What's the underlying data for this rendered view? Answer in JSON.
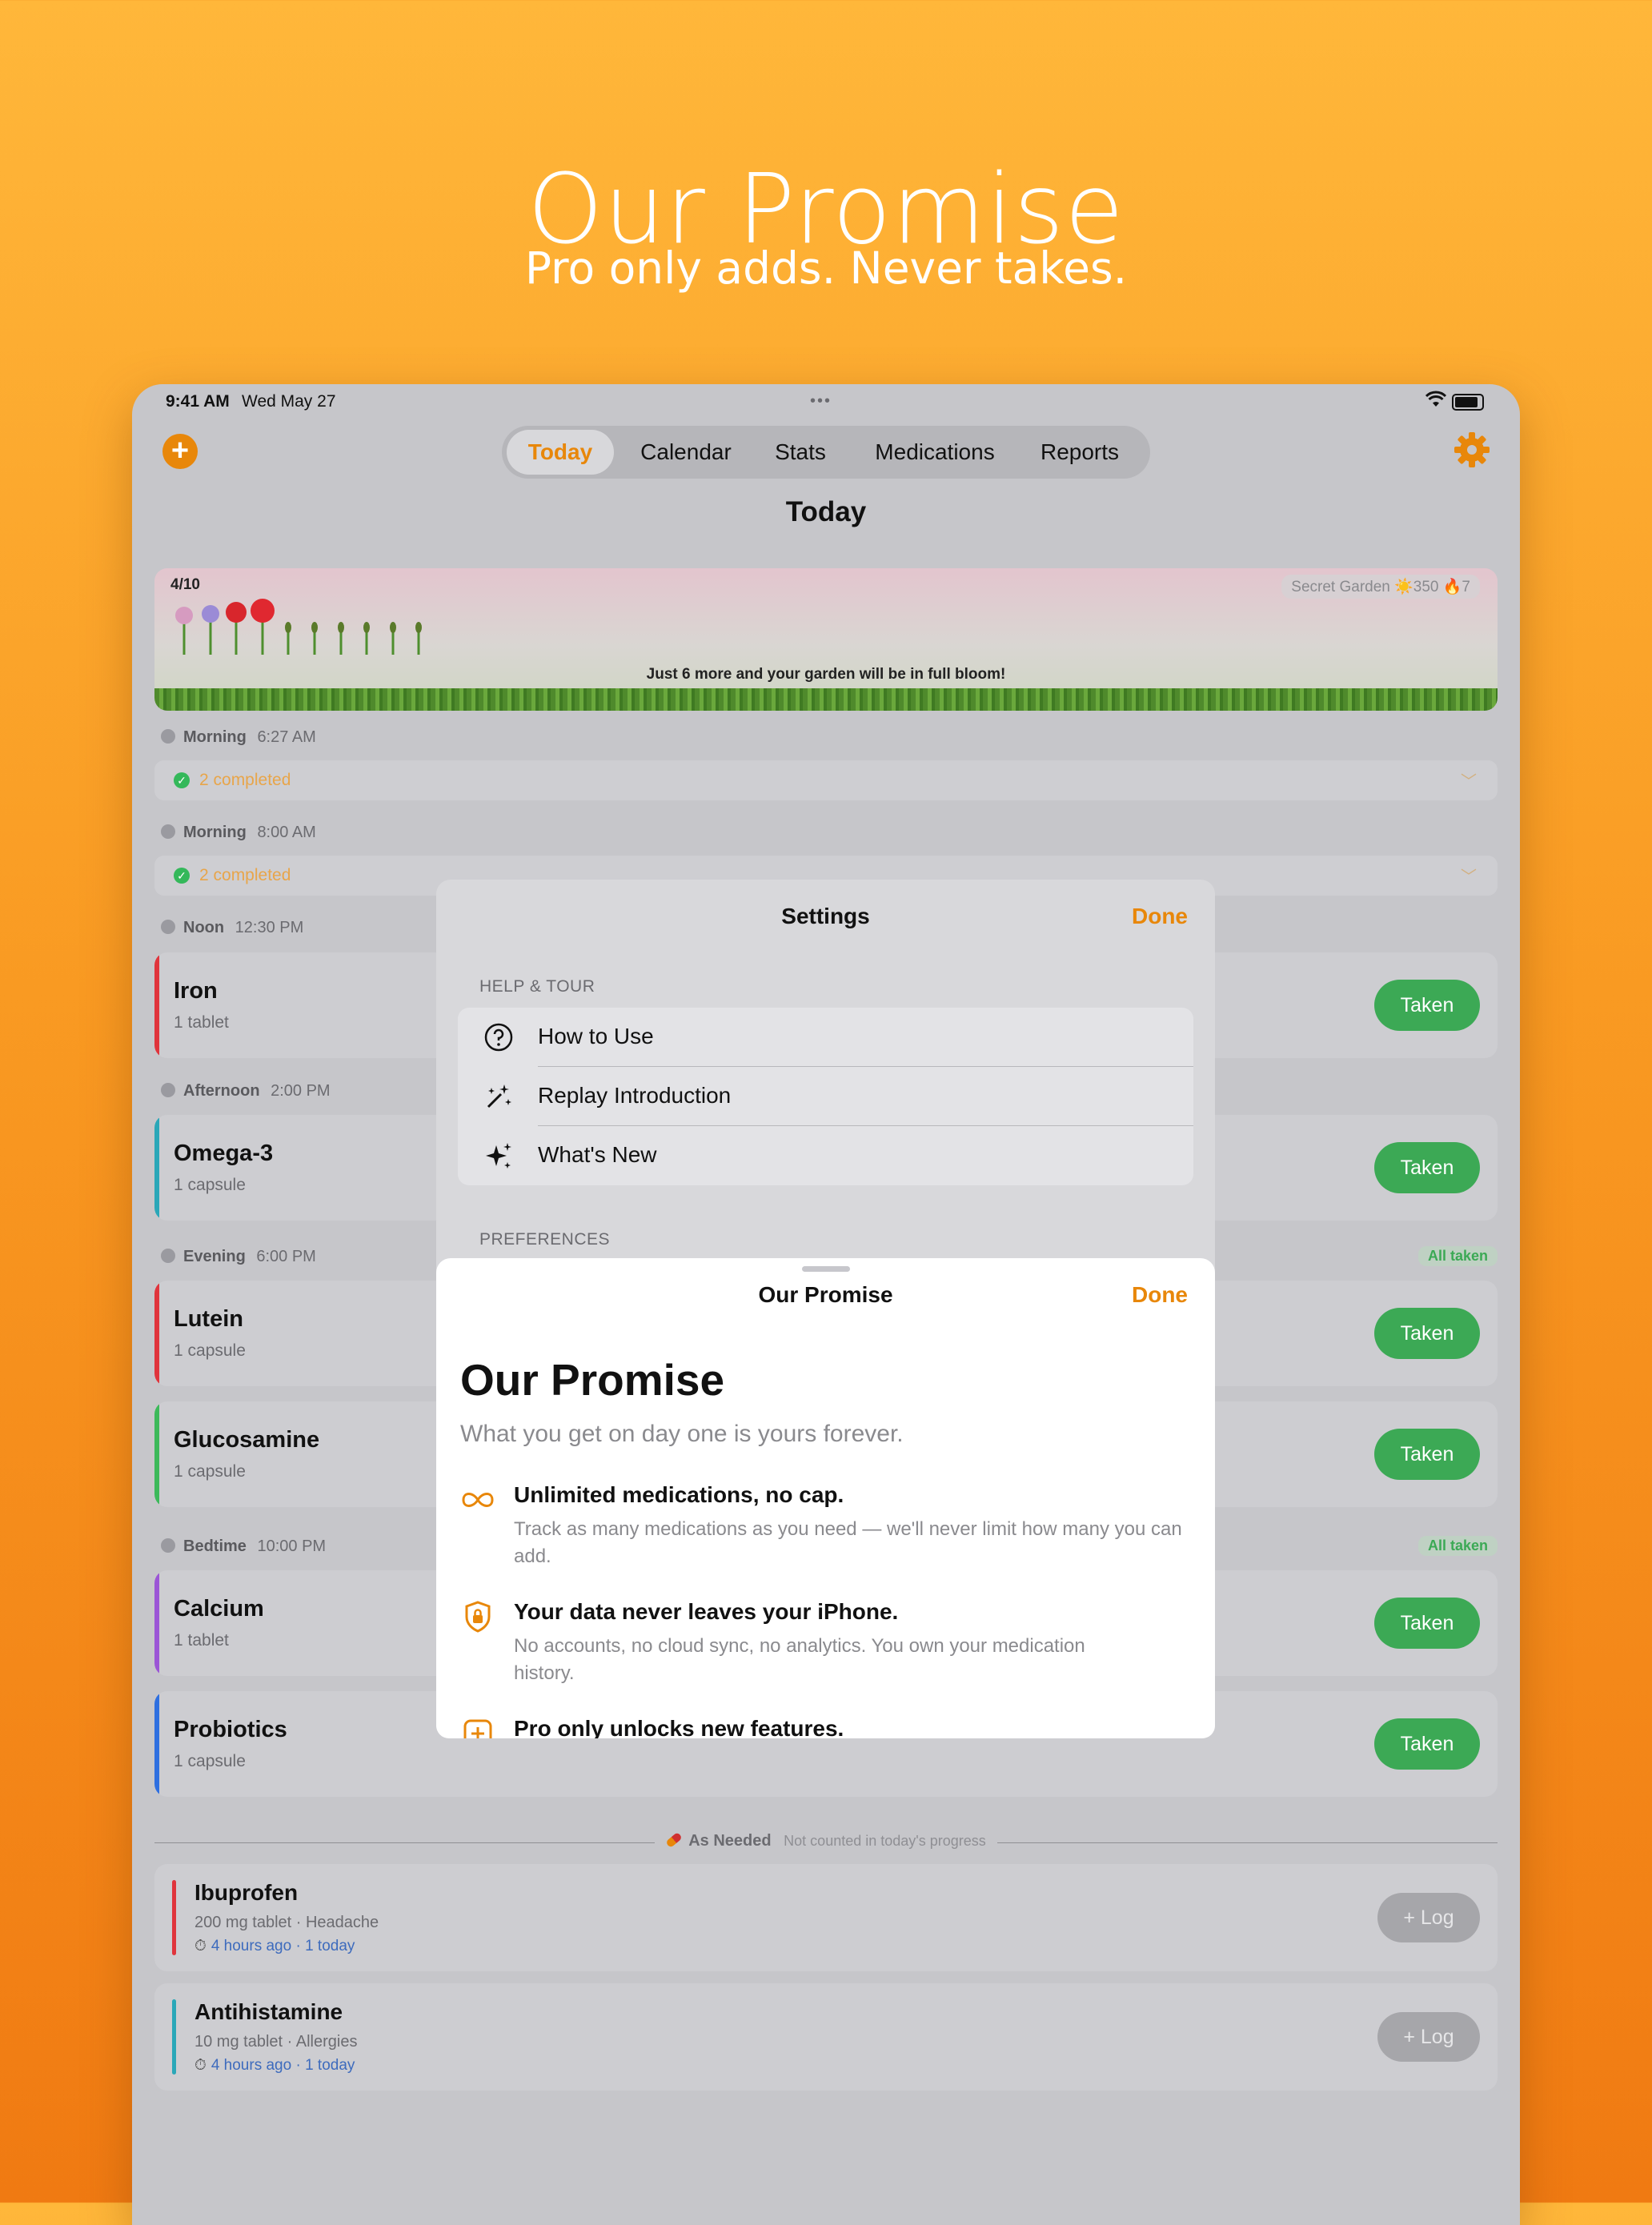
{
  "hero": {
    "title": "Our Promise",
    "subtitle": "Pro only adds. Never takes."
  },
  "statusbar": {
    "time": "9:41 AM",
    "date": "Wed May 27",
    "dots": "•••"
  },
  "toolbar": {
    "add_icon": "+"
  },
  "tabs": [
    {
      "label": "Today",
      "active": true
    },
    {
      "label": "Calendar"
    },
    {
      "label": "Stats"
    },
    {
      "label": "Medications"
    },
    {
      "label": "Reports"
    }
  ],
  "page": {
    "title": "Today"
  },
  "garden": {
    "count": "4/10",
    "badge": "Secret Garden ☀️350 🔥7",
    "message": "Just 6 more and your garden will be in full bloom!"
  },
  "schedule": {
    "morning1": {
      "label": "Morning",
      "time": "6:27 AM",
      "completed": "2 completed"
    },
    "morning2": {
      "label": "Morning",
      "time": "8:00 AM",
      "completed": "2 completed"
    },
    "noon": {
      "label": "Noon",
      "time": "12:30 PM"
    },
    "afternoon": {
      "label": "Afternoon",
      "time": "2:00 PM"
    },
    "evening": {
      "label": "Evening",
      "time": "6:00 PM",
      "badge": "All taken"
    },
    "bedtime": {
      "label": "Bedtime",
      "time": "10:00 PM",
      "badge": "All taken"
    }
  },
  "medications": [
    {
      "name": "Iron",
      "dose": "1 tablet",
      "button": "Taken",
      "color": "#E0343C"
    },
    {
      "name": "Omega-3",
      "dose": "1 capsule",
      "button": "Taken",
      "color": "#2AA7B8"
    },
    {
      "name": "Lutein",
      "dose": "1 capsule",
      "button": "Taken",
      "color": "#E0343C"
    },
    {
      "name": "Glucosamine",
      "dose": "1 capsule",
      "button": "Taken",
      "color": "#3CB95A"
    },
    {
      "name": "Calcium",
      "dose": "1 tablet",
      "button": "Taken",
      "color": "#9B55D6"
    },
    {
      "name": "Probiotics",
      "dose": "1 capsule",
      "button": "Taken",
      "color": "#2E6FE0"
    }
  ],
  "as_needed": {
    "label": "As Needed",
    "note": "Not counted in today's progress",
    "items": [
      {
        "name": "Ibuprofen",
        "dose": "200 mg tablet · Headache",
        "last": "4 hours ago · 1 today",
        "button": "+ Log",
        "color": "#E0343C"
      },
      {
        "name": "Antihistamine",
        "dose": "10 mg tablet · Allergies",
        "last": "4 hours ago · 1 today",
        "button": "+ Log",
        "color": "#2AA7B8"
      }
    ]
  },
  "settings": {
    "title": "Settings",
    "done": "Done",
    "section_help": "HELP & TOUR",
    "rows": [
      {
        "label": "How to Use",
        "icon": "question-circle-icon"
      },
      {
        "label": "Replay Introduction",
        "icon": "magic-wand-icon"
      },
      {
        "label": "What's New",
        "icon": "sparkles-icon"
      }
    ],
    "section_prefs": "PREFERENCES"
  },
  "promise": {
    "nav_title": "Our Promise",
    "done": "Done",
    "heading": "Our Promise",
    "subheading": "What you get on day one is yours forever.",
    "items": [
      {
        "icon": "infinity-icon",
        "title": "Unlimited medications, no cap.",
        "desc": "Track as many medications as you need — we'll never limit how many you can add."
      },
      {
        "icon": "lock-shield-icon",
        "title": "Your data never leaves your iPhone.",
        "desc": "No accounts, no cloud sync, no analytics. You own your medication history."
      },
      {
        "icon": "plus-square-icon",
        "title": "Pro only unlocks new features.",
        "desc": ""
      }
    ]
  },
  "colors": {
    "accent": "#E8870A",
    "taken": "#3CA955",
    "link": "#3D6BBD"
  }
}
